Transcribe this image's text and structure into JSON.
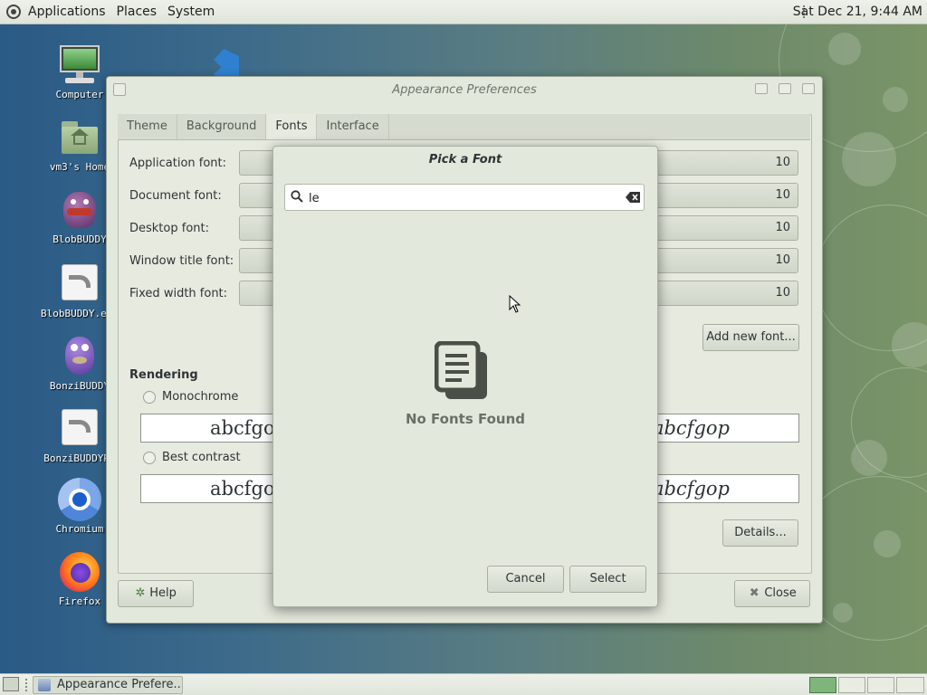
{
  "top_panel": {
    "menus": [
      "Applications",
      "Places",
      "System"
    ],
    "clock": "Sat Dec 21,  9:44 AM"
  },
  "desktop_icons": [
    {
      "label": "Computer",
      "icon": "computer-icon"
    },
    {
      "label": "vm3's Home",
      "icon": "home-folder-icon"
    },
    {
      "label": "BlobBUDDY",
      "icon": "blobbuddy-icon"
    },
    {
      "label": "BlobBUDDY.exe",
      "icon": "shortcut-icon"
    },
    {
      "label": "BonziBUDDY",
      "icon": "bonzibuddy-icon"
    },
    {
      "label": "BonziBUDDYRW",
      "icon": "shortcut-icon"
    },
    {
      "label": "Chromium",
      "icon": "chromium-icon"
    },
    {
      "label": "Firefox",
      "icon": "firefox-icon"
    }
  ],
  "appearance": {
    "title": "Appearance Preferences",
    "tabs": [
      "Theme",
      "Background",
      "Fonts",
      "Interface"
    ],
    "active_tab": "Fonts",
    "font_rows": [
      {
        "label": "Application font:",
        "size": "10"
      },
      {
        "label": "Document font:",
        "size": "10"
      },
      {
        "label": "Desktop font:",
        "size": "10"
      },
      {
        "label": "Window title font:",
        "size": "10"
      },
      {
        "label": "Fixed width font:",
        "size": "10"
      }
    ],
    "add_font_label": "Add new font...",
    "rendering_title": "Rendering",
    "rendering_options": [
      {
        "label": "Monochrome",
        "sample": "abcfgop"
      },
      {
        "label": "Best contrast",
        "sample": "abcfgop"
      }
    ],
    "details_label": "Details...",
    "help_label": "Help",
    "close_label": "Close"
  },
  "font_dialog": {
    "title": "Pick a Font",
    "search_value": "le",
    "empty_text": "No Fonts Found",
    "cancel_label": "Cancel",
    "select_label": "Select"
  },
  "taskbar": {
    "task_label": "Appearance Prefere..."
  }
}
